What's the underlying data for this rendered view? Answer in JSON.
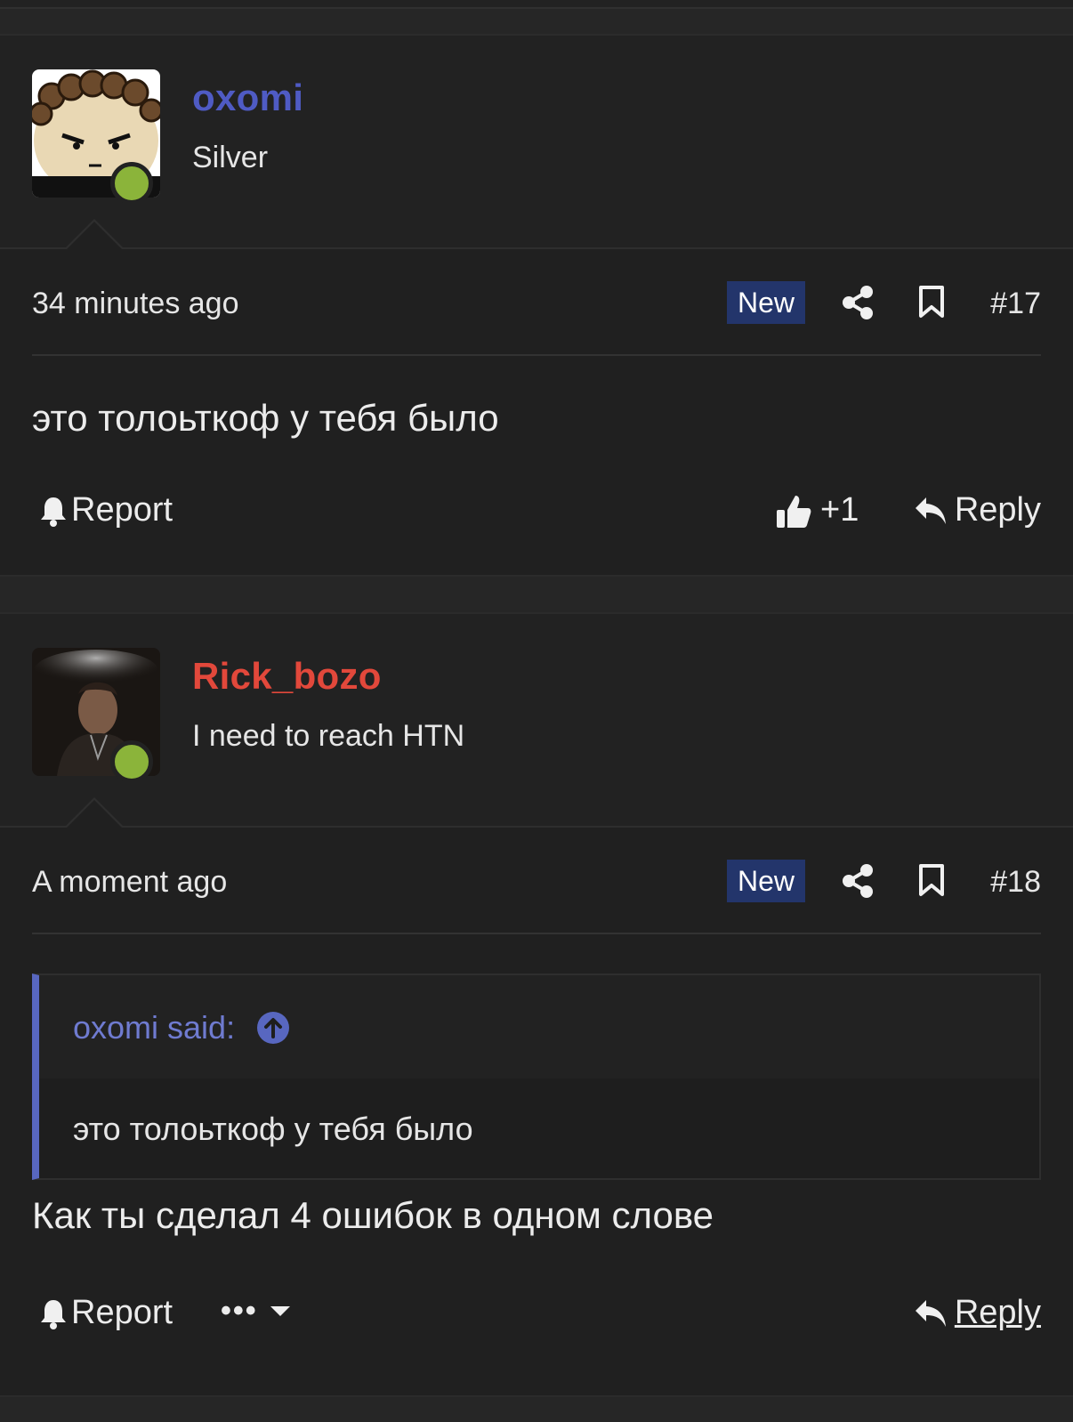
{
  "colors": {
    "accent_blue": "#4f5bc4",
    "accent_red": "#e2483b",
    "online": "#8bb43a",
    "badge_bg": "#23356b",
    "quote_bar": "#5867c0"
  },
  "posts": [
    {
      "username": "oxomi",
      "user_title": "Silver",
      "time": "34 minutes ago",
      "badge": "New",
      "number": "#17",
      "body": "это толоьткоф у тебя было",
      "actions": {
        "report": "Report",
        "like_count": "+1",
        "reply": "Reply"
      }
    },
    {
      "username": "Rick_bozo",
      "user_title": "I need to reach HTN",
      "time": "A moment ago",
      "badge": "New",
      "number": "#18",
      "quote": {
        "author": "oxomi said:",
        "text": "это толоьткоф у тебя было"
      },
      "body": "Как ты сделал 4 ошибок в одном слове",
      "actions": {
        "report": "Report",
        "more": "•••",
        "reply": "Reply"
      }
    }
  ]
}
